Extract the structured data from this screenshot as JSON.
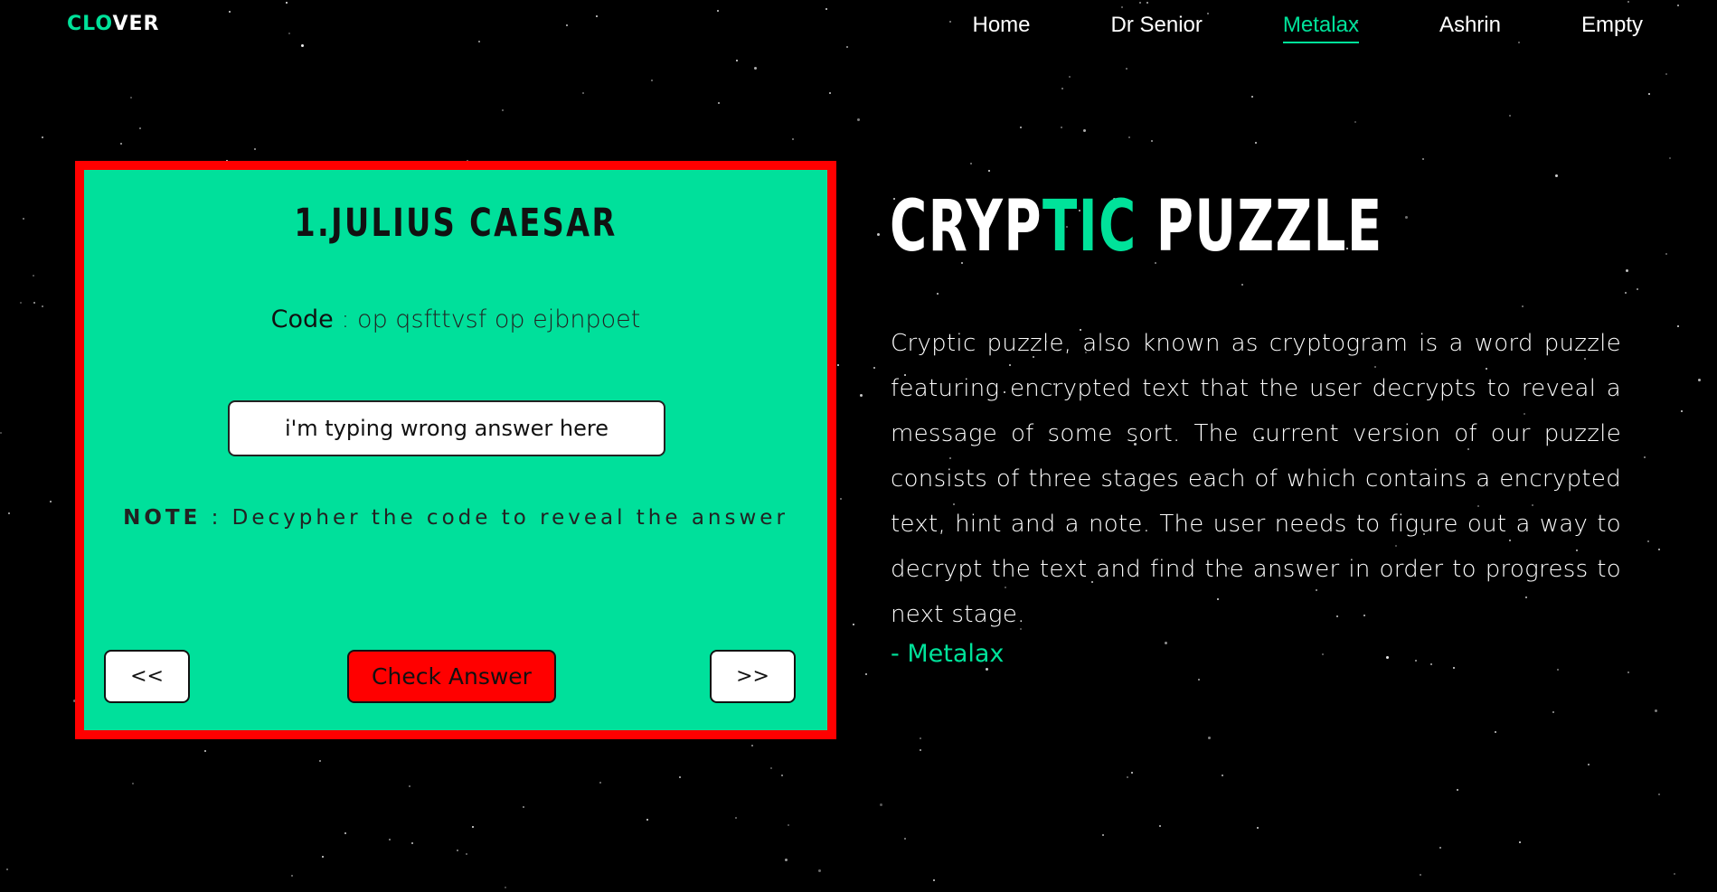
{
  "header": {
    "logo_part1": "CLO",
    "logo_part2": "VER",
    "nav": [
      "Home",
      "Dr Senior",
      "Metalax",
      "Ashrin",
      "Empty"
    ],
    "active_nav": "Metalax"
  },
  "puzzle": {
    "title": "1.JULIUS CAESAR",
    "code_label": "Code",
    "code_value": " : op qsfttvsf op ejbnpoet",
    "answer_value": "i'm typing wrong answer here",
    "note_label": "NOTE",
    "note_text": " : Decypher the code to reveal the answer",
    "prev_label": "<<",
    "check_label": "Check Answer",
    "next_label": ">>"
  },
  "info": {
    "headline_part1": "CRYP",
    "headline_part2": "TIC",
    "headline_part3": " PUZZLE",
    "description": "Cryptic puzzle, also known as cryptogram is a word puzzle featuring encrypted text that the user decrypts to reveal a message of some sort. The current version of our puzzle consists of three stages each of which contains a encrypted text, hint and a note. The user needs to figure out a way to decrypt the text and find the answer in order to progress to next stage.",
    "author": "- Metalax"
  },
  "colors": {
    "accent": "#00e29a",
    "card_bg": "#00e09b",
    "card_border": "#ff0000",
    "check_button": "#ff0000",
    "background": "#000000"
  }
}
